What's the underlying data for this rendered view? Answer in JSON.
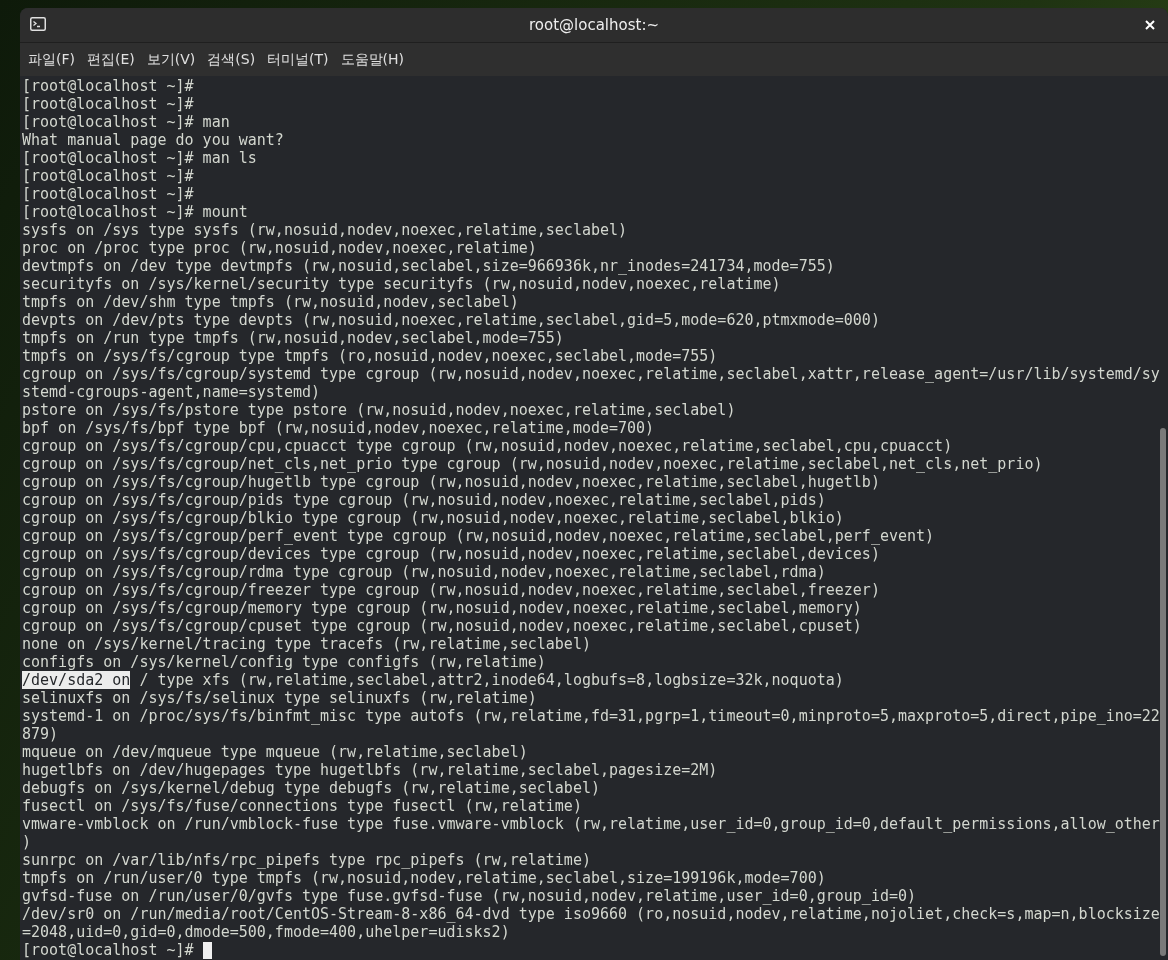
{
  "window": {
    "title": "root@localhost:~"
  },
  "menu": [
    {
      "label": "파일(F)"
    },
    {
      "label": "편집(E)"
    },
    {
      "label": "보기(V)"
    },
    {
      "label": "검색(S)"
    },
    {
      "label": "터미널(T)"
    },
    {
      "label": "도움말(H)"
    }
  ],
  "terminal": {
    "lines": [
      {
        "text": "[root@localhost ~]#"
      },
      {
        "text": "[root@localhost ~]#"
      },
      {
        "text": "[root@localhost ~]# man"
      },
      {
        "text": "What manual page do you want?"
      },
      {
        "text": "[root@localhost ~]# man ls"
      },
      {
        "text": "[root@localhost ~]#"
      },
      {
        "text": "[root@localhost ~]#"
      },
      {
        "text": "[root@localhost ~]# mount"
      },
      {
        "text": "sysfs on /sys type sysfs (rw,nosuid,nodev,noexec,relatime,seclabel)"
      },
      {
        "text": "proc on /proc type proc (rw,nosuid,nodev,noexec,relatime)"
      },
      {
        "text": "devtmpfs on /dev type devtmpfs (rw,nosuid,seclabel,size=966936k,nr_inodes=241734,mode=755)"
      },
      {
        "text": "securityfs on /sys/kernel/security type securityfs (rw,nosuid,nodev,noexec,relatime)"
      },
      {
        "text": "tmpfs on /dev/shm type tmpfs (rw,nosuid,nodev,seclabel)"
      },
      {
        "text": "devpts on /dev/pts type devpts (rw,nosuid,noexec,relatime,seclabel,gid=5,mode=620,ptmxmode=000)"
      },
      {
        "text": "tmpfs on /run type tmpfs (rw,nosuid,nodev,seclabel,mode=755)"
      },
      {
        "text": "tmpfs on /sys/fs/cgroup type tmpfs (ro,nosuid,nodev,noexec,seclabel,mode=755)"
      },
      {
        "text": "cgroup on /sys/fs/cgroup/systemd type cgroup (rw,nosuid,nodev,noexec,relatime,seclabel,xattr,release_agent=/usr/lib/systemd/sy"
      },
      {
        "text": "stemd-cgroups-agent,name=systemd)"
      },
      {
        "text": "pstore on /sys/fs/pstore type pstore (rw,nosuid,nodev,noexec,relatime,seclabel)"
      },
      {
        "text": "bpf on /sys/fs/bpf type bpf (rw,nosuid,nodev,noexec,relatime,mode=700)"
      },
      {
        "text": "cgroup on /sys/fs/cgroup/cpu,cpuacct type cgroup (rw,nosuid,nodev,noexec,relatime,seclabel,cpu,cpuacct)"
      },
      {
        "text": "cgroup on /sys/fs/cgroup/net_cls,net_prio type cgroup (rw,nosuid,nodev,noexec,relatime,seclabel,net_cls,net_prio)"
      },
      {
        "text": "cgroup on /sys/fs/cgroup/hugetlb type cgroup (rw,nosuid,nodev,noexec,relatime,seclabel,hugetlb)"
      },
      {
        "text": "cgroup on /sys/fs/cgroup/pids type cgroup (rw,nosuid,nodev,noexec,relatime,seclabel,pids)"
      },
      {
        "text": "cgroup on /sys/fs/cgroup/blkio type cgroup (rw,nosuid,nodev,noexec,relatime,seclabel,blkio)"
      },
      {
        "text": "cgroup on /sys/fs/cgroup/perf_event type cgroup (rw,nosuid,nodev,noexec,relatime,seclabel,perf_event)"
      },
      {
        "text": "cgroup on /sys/fs/cgroup/devices type cgroup (rw,nosuid,nodev,noexec,relatime,seclabel,devices)"
      },
      {
        "text": "cgroup on /sys/fs/cgroup/rdma type cgroup (rw,nosuid,nodev,noexec,relatime,seclabel,rdma)"
      },
      {
        "text": "cgroup on /sys/fs/cgroup/freezer type cgroup (rw,nosuid,nodev,noexec,relatime,seclabel,freezer)"
      },
      {
        "text": "cgroup on /sys/fs/cgroup/memory type cgroup (rw,nosuid,nodev,noexec,relatime,seclabel,memory)"
      },
      {
        "text": "cgroup on /sys/fs/cgroup/cpuset type cgroup (rw,nosuid,nodev,noexec,relatime,seclabel,cpuset)"
      },
      {
        "text": "none on /sys/kernel/tracing type tracefs (rw,relatime,seclabel)"
      },
      {
        "text": "configfs on /sys/kernel/config type configfs (rw,relatime)"
      },
      {
        "selected_text": "/dev/sda2 on",
        "text": " / type xfs (rw,relatime,seclabel,attr2,inode64,logbufs=8,logbsize=32k,noquota)"
      },
      {
        "text": "selinuxfs on /sys/fs/selinux type selinuxfs (rw,relatime)"
      },
      {
        "text": "systemd-1 on /proc/sys/fs/binfmt_misc type autofs (rw,relatime,fd=31,pgrp=1,timeout=0,minproto=5,maxproto=5,direct,pipe_ino=22"
      },
      {
        "text": "879)"
      },
      {
        "text": "mqueue on /dev/mqueue type mqueue (rw,relatime,seclabel)"
      },
      {
        "text": "hugetlbfs on /dev/hugepages type hugetlbfs (rw,relatime,seclabel,pagesize=2M)"
      },
      {
        "text": "debugfs on /sys/kernel/debug type debugfs (rw,relatime,seclabel)"
      },
      {
        "text": "fusectl on /sys/fs/fuse/connections type fusectl (rw,relatime)"
      },
      {
        "text": "vmware-vmblock on /run/vmblock-fuse type fuse.vmware-vmblock (rw,relatime,user_id=0,group_id=0,default_permissions,allow_other"
      },
      {
        "text": ")"
      },
      {
        "text": "sunrpc on /var/lib/nfs/rpc_pipefs type rpc_pipefs (rw,relatime)"
      },
      {
        "text": "tmpfs on /run/user/0 type tmpfs (rw,nosuid,nodev,relatime,seclabel,size=199196k,mode=700)"
      },
      {
        "text": "gvfsd-fuse on /run/user/0/gvfs type fuse.gvfsd-fuse (rw,nosuid,nodev,relatime,user_id=0,group_id=0)"
      },
      {
        "text": "/dev/sr0 on /run/media/root/CentOS-Stream-8-x86_64-dvd type iso9660 (ro,nosuid,nodev,relatime,nojoliet,check=s,map=n,blocksize"
      },
      {
        "text": "=2048,uid=0,gid=0,dmode=500,fmode=400,uhelper=udisks2)"
      },
      {
        "text": "[root@localhost ~]# ",
        "cursor": true
      }
    ]
  }
}
